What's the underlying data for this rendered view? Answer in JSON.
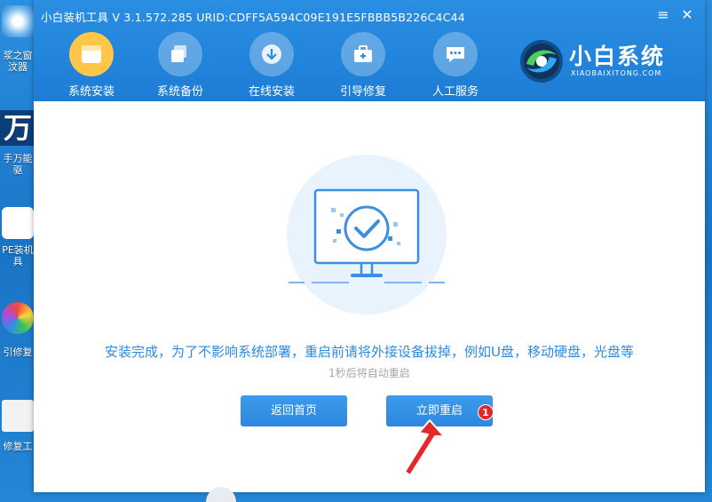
{
  "window": {
    "title": "小白装机工具 V 3.1.572.285 URID:CDFF5A594C09E191E5FBBB5B226C4C44",
    "menu_glyph": "≡",
    "close_glyph": "✕"
  },
  "nav": {
    "items": [
      {
        "label": "系统安装",
        "icon": "system-install-icon",
        "active": true
      },
      {
        "label": "系统备份",
        "icon": "backup-icon",
        "active": false
      },
      {
        "label": "在线安装",
        "icon": "download-icon",
        "active": false
      },
      {
        "label": "引导修复",
        "icon": "toolbox-icon",
        "active": false
      },
      {
        "label": "人工服务",
        "icon": "chat-icon",
        "active": false
      }
    ]
  },
  "logo": {
    "name": "小白系统",
    "domain": "XIAOBAIXITONG.COM"
  },
  "main": {
    "message": "安装完成，为了不影响系统部署，重启前请将外接设备拔掉，例如U盘，移动硬盘，光盘等",
    "countdown": "1秒后将自动重启",
    "back_button": "返回首页",
    "restart_button": "立即重启",
    "badge": "1"
  },
  "desktop": {
    "icons": [
      {
        "label": "浆之窗汶器"
      },
      {
        "label": "万"
      },
      {
        "label": "手万能驱"
      },
      {
        "label": "PE装机具"
      },
      {
        "label": "引修复"
      },
      {
        "label": "修复工"
      }
    ]
  },
  "colors": {
    "header": "#1d7dd5",
    "accent": "#2c8ae0",
    "active_nav": "#ffc64a",
    "badge": "#e0282b"
  }
}
